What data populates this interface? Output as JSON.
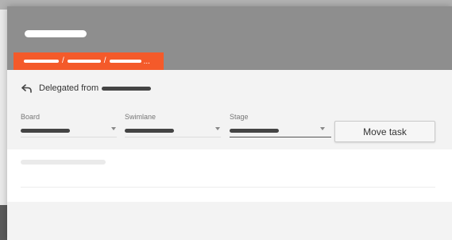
{
  "dialog": {
    "delegated_label": "Delegated from",
    "move_button_label": "Move task",
    "breadcrumb_separator": "/",
    "breadcrumb_ellipsis": "..."
  },
  "fields": {
    "board": {
      "label": "Board"
    },
    "swimlane": {
      "label": "Swimlane"
    },
    "stage": {
      "label": "Stage"
    }
  },
  "colors": {
    "header": "#8e8e8e",
    "breadcrumb": "#f45a2a",
    "body": "#f3f3f3"
  },
  "icons": {
    "delegated": "reply-arrow-icon"
  }
}
